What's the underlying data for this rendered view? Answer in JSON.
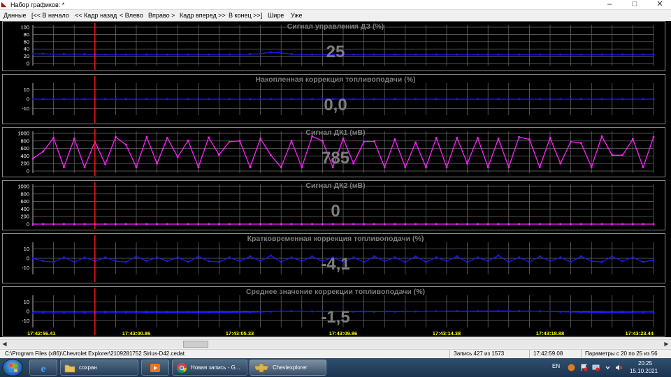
{
  "window": {
    "title": "Набор графиков: *",
    "controls": [
      "–",
      "□",
      "✕"
    ]
  },
  "menu": [
    "Данные",
    "[<< В начало",
    "<< Кадр назад",
    "< Влево",
    "Вправо >",
    "Кадр вперед >>",
    "В конец >>]",
    "Шире",
    "Уже"
  ],
  "colors": {
    "background": "#000000",
    "grid": "#6e6e6e",
    "axis_text": "#ffffff",
    "title_text": "#7d7d7d",
    "cursor": "#ff1414",
    "blue_series": "#1a1aff",
    "magenta_series": "#ff20ff"
  },
  "cursor": {
    "time": "17:42:59.08"
  },
  "chart_data": [
    {
      "type": "line",
      "title": "Сигнал управления ДЗ  (%)",
      "current_value": "25",
      "ylim": [
        0,
        100
      ],
      "yticks": [
        "100",
        "80",
        "60",
        "40",
        "20",
        "0"
      ],
      "grid": true,
      "color": "blue",
      "values": [
        27,
        27,
        26,
        26,
        26,
        26,
        25,
        25,
        25,
        25,
        25,
        25,
        25,
        25,
        25,
        25,
        25,
        25,
        25,
        25,
        25,
        26,
        27,
        31,
        29,
        26,
        25,
        25,
        25,
        25,
        25,
        25,
        25,
        25,
        25,
        25,
        25,
        25,
        25,
        25,
        25,
        25,
        25,
        25,
        25,
        25,
        25,
        25,
        25,
        25,
        25,
        25,
        25,
        25,
        25,
        25,
        25,
        25,
        25,
        25,
        25
      ]
    },
    {
      "type": "line",
      "title": "Накопленная коррекция топливоподачи  (%)",
      "current_value": "0,0",
      "ylim": [
        -15,
        15
      ],
      "yticks": [
        "10",
        "0",
        "-10"
      ],
      "grid": true,
      "color": "blue",
      "values": [
        0,
        0,
        0,
        0,
        0,
        0,
        0,
        0,
        0,
        0,
        0,
        0,
        0,
        0,
        0,
        0,
        0,
        0,
        0,
        0,
        0,
        0,
        0,
        0,
        0,
        0,
        0,
        0,
        0,
        0,
        0,
        0,
        0,
        0,
        0,
        0,
        0,
        0,
        0,
        0,
        0,
        0,
        0,
        0,
        0,
        0,
        0,
        0,
        0,
        0,
        0,
        0,
        0,
        0,
        0,
        0,
        0,
        0,
        0,
        0,
        0
      ]
    },
    {
      "type": "line",
      "title": "Сигнал ДК1  (мВ)",
      "current_value": "785",
      "ylim": [
        0,
        1000
      ],
      "yticks": [
        "1000",
        "800",
        "600",
        "400",
        "200",
        "0"
      ],
      "grid": true,
      "color": "magenta",
      "values": [
        330,
        520,
        880,
        100,
        860,
        100,
        780,
        180,
        900,
        700,
        100,
        900,
        200,
        880,
        370,
        810,
        100,
        890,
        430,
        780,
        800,
        100,
        860,
        420,
        100,
        800,
        100,
        920,
        800,
        100,
        860,
        200,
        780,
        790,
        100,
        840,
        100,
        760,
        100,
        880,
        100,
        880,
        200,
        880,
        100,
        860,
        100,
        900,
        840,
        100,
        880,
        200,
        780,
        740,
        100,
        920,
        420,
        420,
        850,
        100,
        900
      ]
    },
    {
      "type": "line",
      "title": "Сигнал ДК2  (мВ)",
      "current_value": "0",
      "ylim": [
        0,
        1000
      ],
      "yticks": [
        "1000",
        "800",
        "600",
        "400",
        "200",
        "0"
      ],
      "grid": true,
      "color": "magenta",
      "values": [
        0,
        0,
        0,
        0,
        0,
        0,
        0,
        0,
        0,
        0,
        0,
        0,
        0,
        0,
        0,
        0,
        0,
        0,
        0,
        0,
        0,
        0,
        0,
        0,
        0,
        0,
        0,
        0,
        0,
        0,
        0,
        0,
        0,
        0,
        0,
        0,
        0,
        0,
        0,
        0,
        0,
        0,
        0,
        0,
        0,
        0,
        0,
        0,
        0,
        0,
        0,
        0,
        0,
        0,
        0,
        0,
        0,
        0,
        0,
        0,
        0
      ]
    },
    {
      "type": "line",
      "title": "Кратковременная коррекция топливоподачи  (%)",
      "current_value": "-4,1",
      "ylim": [
        -15,
        15
      ],
      "yticks": [
        "10",
        "0",
        "-10"
      ],
      "grid": true,
      "color": "blue",
      "values": [
        0,
        -3,
        -4,
        1,
        -4,
        1,
        -3,
        1,
        -3,
        -4,
        2,
        -3,
        1,
        -3,
        1,
        -4,
        2,
        -3,
        -4,
        1,
        -3,
        2,
        -3,
        3,
        -4,
        1,
        -3,
        2,
        -3,
        1,
        -4,
        1,
        -4,
        2,
        -3,
        1,
        -4,
        2,
        -4,
        1,
        -3,
        2,
        -4,
        1,
        -3,
        3,
        -4,
        1,
        -4,
        2,
        -3,
        1,
        -4,
        2,
        -3,
        -4,
        2,
        -3,
        1,
        -4,
        -2
      ]
    },
    {
      "type": "line",
      "title": "Среднее значение коррекции топливоподачи  (%)",
      "current_value": "-1,5",
      "ylim": [
        -15,
        15
      ],
      "yticks": [
        "10",
        "0",
        "-10"
      ],
      "grid": true,
      "color": "blue",
      "values": [
        -1.5,
        -1.5,
        -1.5,
        -1.5,
        -1.5,
        -1.5,
        -1.5,
        -1.4,
        -1.4,
        -1.4,
        -1.4,
        -1.3,
        -1.3,
        -1.2,
        -1.2,
        -1.2,
        -1.1,
        -1.1,
        -1.0,
        -1.0,
        -0.9,
        -0.8,
        -0.6,
        -0.2,
        0.2,
        0.2,
        0.0,
        -0.1,
        -0.3,
        -0.4,
        -0.4,
        -0.4,
        -0.4,
        -0.4,
        -0.3,
        -0.3,
        -0.2,
        -0.1,
        0.0,
        0.1,
        0.2,
        0.3,
        0.3,
        0.4,
        0.4,
        0.4,
        0.4,
        0.3,
        0.2,
        0.0,
        -0.2,
        -0.4,
        -0.6,
        -0.8,
        -1.0,
        -1.1,
        -1.2,
        -1.3,
        -1.4,
        -1.5,
        -1.5
      ]
    }
  ],
  "time_axis": [
    "17:42:56.41",
    "17:43:00.86",
    "17:43:05.33",
    "17:43:09.86",
    "17:43:14.38",
    "17:43:18.88",
    "17:43:23.44"
  ],
  "statusbar": {
    "path": "C:\\Program Files (x86)\\Chevrolet Explorer\\2109281752 Sirius-D42.cedat",
    "record": "Запись 427 из 1573",
    "time": "17:42:59.08",
    "params": "Параметры с 20 по 25 из 56"
  },
  "taskbar": {
    "items": [
      {
        "label": "",
        "icon": "ie-icon"
      },
      {
        "label": "сохран",
        "icon": "folder-icon"
      },
      {
        "label": "",
        "icon": "media-player-icon"
      },
      {
        "label": "Новая запись - G...",
        "icon": "chrome-icon"
      },
      {
        "label": "Cheviexplorer",
        "icon": "chevrolet-icon"
      }
    ],
    "lang": "EN",
    "clock_time": "20:25",
    "clock_date": "15.10.2021"
  }
}
